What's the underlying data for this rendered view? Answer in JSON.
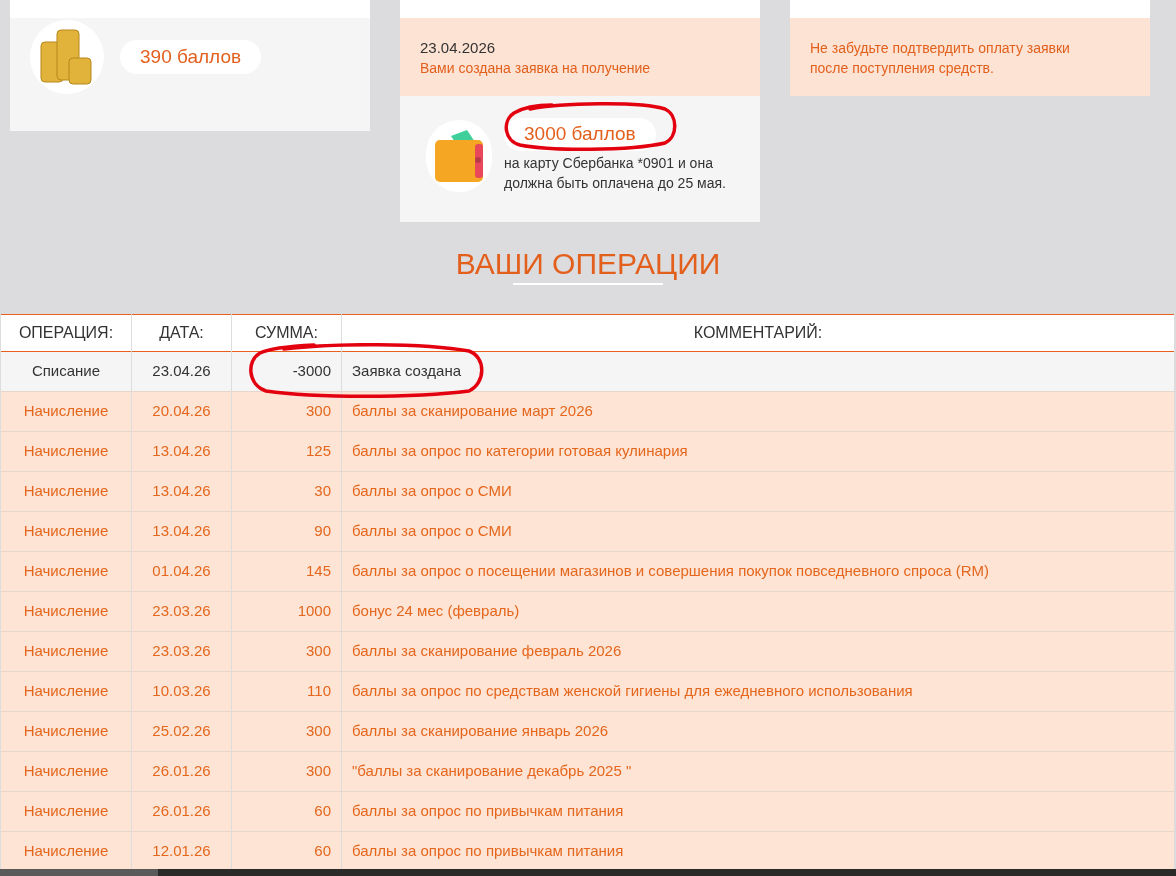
{
  "balance_card": {
    "amount": "390 баллов"
  },
  "debit_card": {
    "date": "23.04.2026",
    "notice": "Вами создана заявка на получение",
    "amount": "3000 баллов",
    "details": "на карту Сбербанка *0901 и она должна быть оплачена до 25 мая."
  },
  "confirm_card": {
    "notice": "Не забудьте подтвердить оплату заявки после поступления средств."
  },
  "section_title": "ВАШИ ОПЕРАЦИИ",
  "table": {
    "columns": [
      "ОПЕРАЦИЯ:",
      "ДАТА:",
      "СУММА:",
      "КОММЕНТАРИЙ:"
    ],
    "rows": [
      {
        "kind": "debit",
        "operation": "Списание",
        "date": "23.04.26",
        "amount": "-3000",
        "comment": "Заявка создана"
      },
      {
        "kind": "credit",
        "operation": "Начисление",
        "date": "20.04.26",
        "amount": "300",
        "comment": "баллы за сканирование март 2026"
      },
      {
        "kind": "credit",
        "operation": "Начисление",
        "date": "13.04.26",
        "amount": "125",
        "comment": "баллы за опрос по категории готовая кулинария"
      },
      {
        "kind": "credit",
        "operation": "Начисление",
        "date": "13.04.26",
        "amount": "30",
        "comment": "баллы за опрос о СМИ"
      },
      {
        "kind": "credit",
        "operation": "Начисление",
        "date": "13.04.26",
        "amount": "90",
        "comment": "баллы за опрос о СМИ"
      },
      {
        "kind": "credit",
        "operation": "Начисление",
        "date": "01.04.26",
        "amount": "145",
        "comment": "баллы за опрос о посещении магазинов и совершения покупок повседневного спроса (RM)"
      },
      {
        "kind": "credit",
        "operation": "Начисление",
        "date": "23.03.26",
        "amount": "1000",
        "comment": "бонус 24 мес (февраль)"
      },
      {
        "kind": "credit",
        "operation": "Начисление",
        "date": "23.03.26",
        "amount": "300",
        "comment": "баллы за сканирование февраль 2026"
      },
      {
        "kind": "credit",
        "operation": "Начисление",
        "date": "10.03.26",
        "amount": "110",
        "comment": "баллы за опрос по средствам женской гигиены для ежедневного использования"
      },
      {
        "kind": "credit",
        "operation": "Начисление",
        "date": "25.02.26",
        "amount": "300",
        "comment": "баллы за сканирование январь 2026"
      },
      {
        "kind": "credit",
        "operation": "Начисление",
        "date": "26.01.26",
        "amount": "300",
        "comment": "\"баллы за сканирование декабрь 2025 \""
      },
      {
        "kind": "credit",
        "operation": "Начисление",
        "date": "26.01.26",
        "amount": "60",
        "comment": "баллы за опрос по привычкам питания"
      },
      {
        "kind": "credit",
        "operation": "Начисление",
        "date": "12.01.26",
        "amount": "60",
        "comment": "баллы за опрос по привычкам питания"
      }
    ]
  },
  "annotations": [
    {
      "kind": "freehand_circle"
    },
    {
      "kind": "freehand_circle"
    }
  ]
}
